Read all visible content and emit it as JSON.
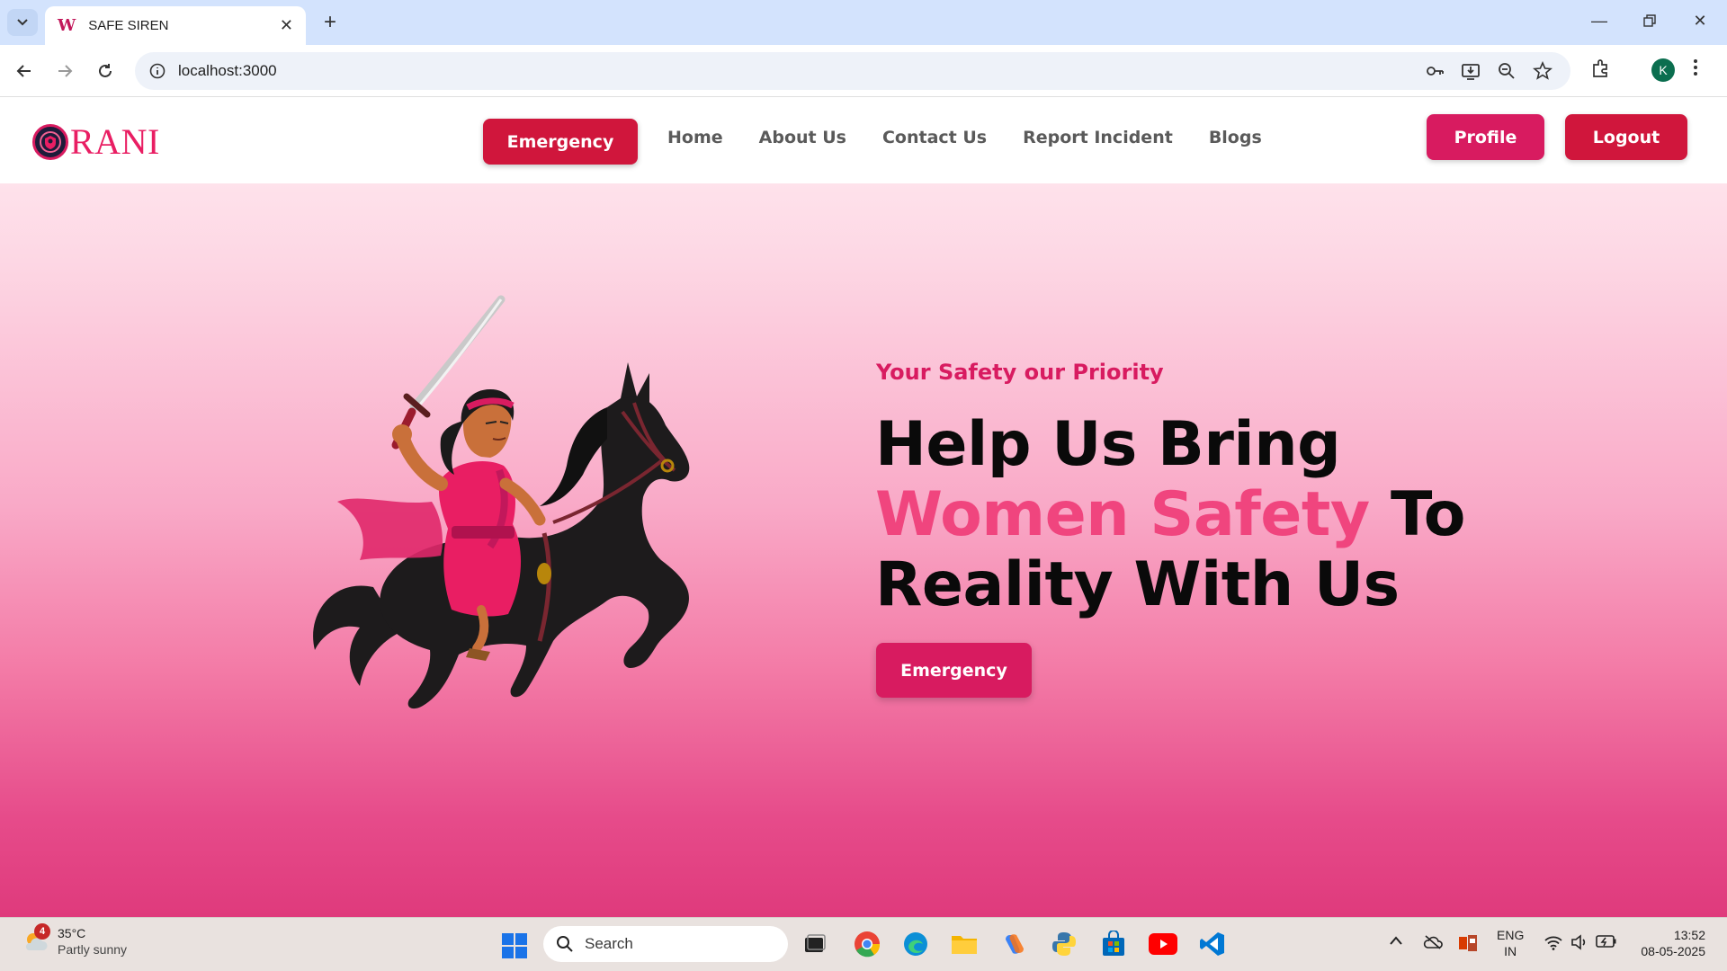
{
  "browser": {
    "tab_title": "SAFE SIREN",
    "favicon_letter": "W",
    "url": "localhost:3000",
    "profile_initial": "K"
  },
  "site": {
    "logo_text": "RANI",
    "nav": {
      "emergency_label": "Emergency",
      "links": [
        "Home",
        "About Us",
        "Contact Us",
        "Report Incident",
        "Blogs"
      ],
      "profile_label": "Profile",
      "logout_label": "Logout"
    },
    "hero": {
      "tagline": "Your Safety our Priority",
      "headline_line1": "Help Us Bring",
      "headline_highlight": "Women Safety",
      "headline_after_highlight": "To",
      "headline_line3": "Reality With Us",
      "cta_label": "Emergency"
    },
    "colors": {
      "brand_pink": "#d81b60",
      "emergency_red": "#d0163c",
      "highlight_pink": "#f0457e"
    }
  },
  "taskbar": {
    "weather_temp": "35°C",
    "weather_desc": "Partly sunny",
    "weather_badge": "4",
    "search_placeholder": "Search",
    "lang_primary": "ENG",
    "lang_region": "IN",
    "time": "13:52",
    "date": "08-05-2025",
    "apps": [
      "task-view",
      "chrome",
      "edge",
      "file-explorer",
      "copilot",
      "python",
      "store",
      "youtube",
      "vscode"
    ]
  }
}
